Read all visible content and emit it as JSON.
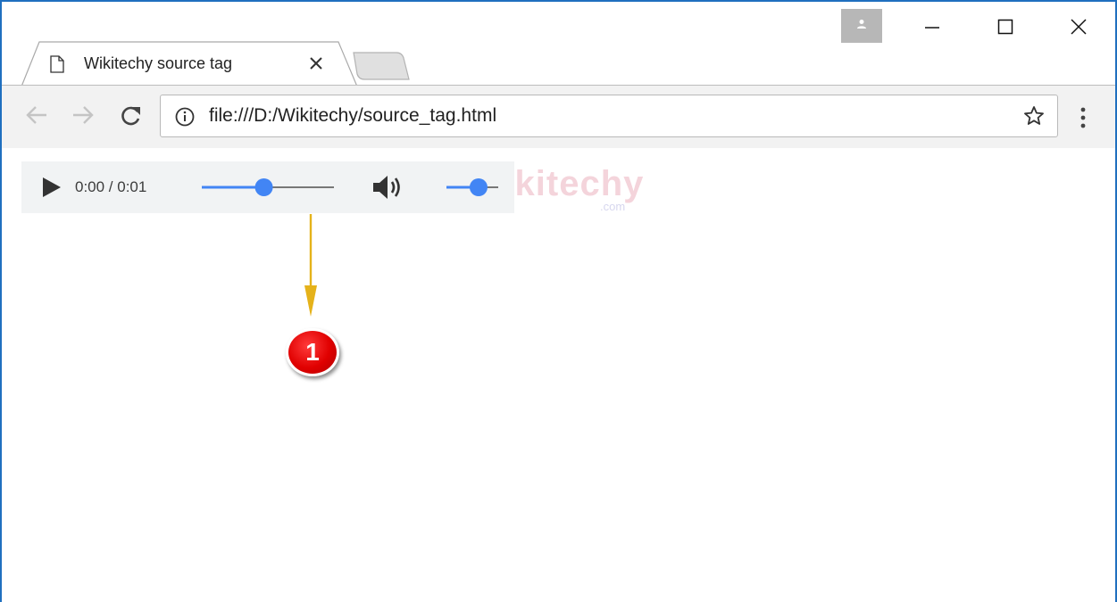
{
  "browser": {
    "tab": {
      "title": "Wikitechy source tag"
    },
    "address_bar": {
      "url": "file:///D:/Wikitechy/source_tag.html"
    }
  },
  "audio_player": {
    "time_display": "0:00 / 0:01",
    "seek_position": 0.47,
    "volume_level": 0.62,
    "accent_color": "#4285f4"
  },
  "watermark": {
    "text": "Wikitechy",
    "sub": ".com"
  },
  "callout": {
    "number": "1",
    "color": "#e00000",
    "arrow_color": "#e5b21a"
  }
}
